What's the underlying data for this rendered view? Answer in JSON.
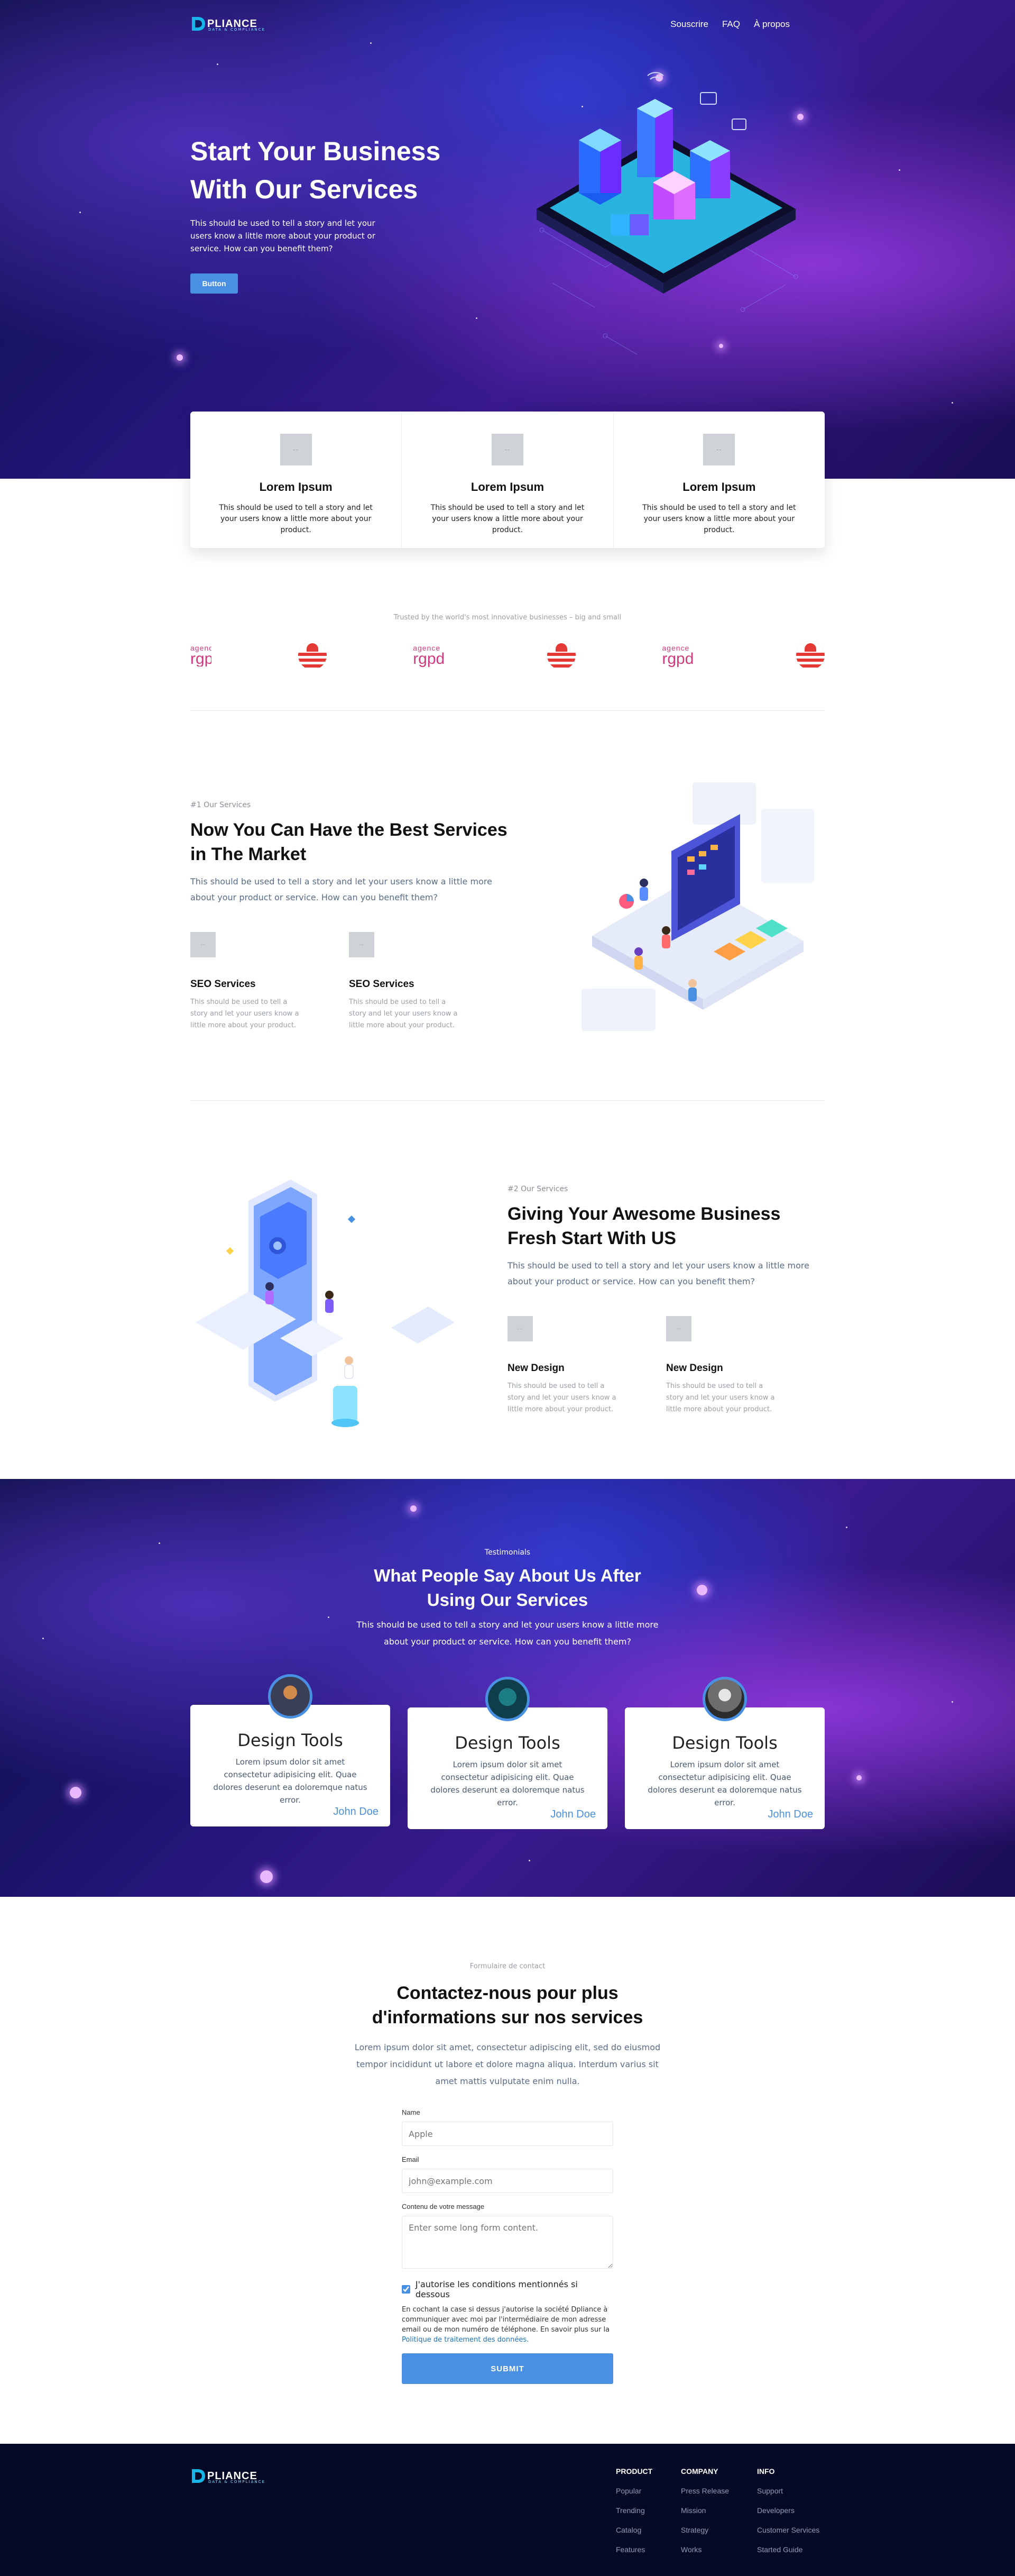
{
  "brand": {
    "name": "PLIANCE",
    "initial": "D",
    "tagline": "DATA & COMPLIANCE"
  },
  "nav": {
    "items": [
      "Souscrire",
      "FAQ",
      "À propos"
    ]
  },
  "hero": {
    "title_line1": "Start Your Business",
    "title_line2": "With Our Services",
    "description": "This should be used to tell a story and let your users know a little more about your product or service. How can you benefit them?",
    "button": "Button"
  },
  "features": [
    {
      "icon": "image-placeholder-icon",
      "title": "Lorem Ipsum",
      "text": "This should be used to tell a story and let your users know a little more about your product."
    },
    {
      "icon": "image-placeholder-icon",
      "title": "Lorem Ipsum",
      "text": "This should be used to tell a story and let your users know a little more about your product."
    },
    {
      "icon": "image-placeholder-icon",
      "title": "Lorem Ipsum",
      "text": "This should be used to tell a story and let your users know a little more about your product."
    }
  ],
  "trusted": {
    "caption": "Trusted by the world's most innovative businesses – big and small",
    "logo_word": "agence",
    "logo_mark": "rgpd"
  },
  "section1": {
    "tag": "#1 Our Services",
    "title_line1": "Now You Can Have the Best Services",
    "title_line2": "in The Market",
    "lead": "This should be used to tell a story and let your users know a little more about your product or service. How can you benefit them?",
    "items": [
      {
        "title": "SEO Services",
        "text": "This should be used to tell a story and let your users know a little more about your product."
      },
      {
        "title": "SEO Services",
        "text": "This should be used to tell a story and let your users know a little more about your product."
      }
    ]
  },
  "section2": {
    "tag": "#2 Our Services",
    "title_line1": "Giving Your Awesome Business",
    "title_line2": "Fresh Start With US",
    "lead": "This should be used to tell a story and let your users know a little more about your product or service. How can you benefit them?",
    "items": [
      {
        "title": "New Design",
        "text": "This should be used to tell a story and let your users know a little more about your product."
      },
      {
        "title": "New Design",
        "text": "This should be used to tell a story and let your users know a little more about your product."
      }
    ]
  },
  "testimonials": {
    "tag": "Testimonials",
    "title_line1": "What People Say About Us After",
    "title_line2": "Using Our Services",
    "lead": "This should be used to tell a story and let your users know a little more about your product or service. How can you benefit them?",
    "cards": [
      {
        "title": "Design Tools",
        "text": "Lorem ipsum dolor sit amet consectetur adipisicing elit. Quae dolores deserunt ea doloremque natus error.",
        "author": "John Doe"
      },
      {
        "title": "Design Tools",
        "text": "Lorem ipsum dolor sit amet consectetur adipisicing elit. Quae dolores deserunt ea doloremque natus error.",
        "author": "John Doe"
      },
      {
        "title": "Design Tools",
        "text": "Lorem ipsum dolor sit amet consectetur adipisicing elit. Quae dolores deserunt ea doloremque natus error.",
        "author": "John Doe"
      }
    ]
  },
  "contact": {
    "tag": "Formulaire de contact",
    "title_line1": "Contactez-nous pour plus",
    "title_line2": "d'informations sur nos services",
    "lead": "Lorem ipsum dolor sit amet, consectetur adipiscing elit, sed do eiusmod tempor incididunt ut labore et dolore magna aliqua. Interdum varius sit amet mattis vulputate enim nulla.",
    "name_label": "Name",
    "name_placeholder": "Apple",
    "email_label": "Email",
    "email_placeholder": "john@example.com",
    "message_label": "Contenu de votre message",
    "message_placeholder": "Enter some long form content.",
    "consent_label": "J'autorise les conditions mentionnés si dessous",
    "legal_text": "En cochant la case si dessus j'autorise la société Dpliance à communiquer avec moi par l'intermédiaire de mon adresse email ou de mon numéro de téléphone. En savoir plus sur la",
    "legal_link": "Politique de traitement des données.",
    "submit": "SUBMIT"
  },
  "footer": {
    "columns": [
      {
        "title": "PRODUCT",
        "links": [
          "Popular",
          "Trending",
          "Catalog",
          "Features"
        ]
      },
      {
        "title": "COMPANY",
        "links": [
          "Press Release",
          "Mission",
          "Strategy",
          "Works"
        ]
      },
      {
        "title": "INFO",
        "links": [
          "Support",
          "Developers",
          "Customer Services",
          "Started Guide"
        ]
      }
    ]
  },
  "colors": {
    "accent": "#4a90e2",
    "footer_bg": "#040a26",
    "logo_pink": "#d23a7e",
    "flag_red": "#e53936"
  }
}
